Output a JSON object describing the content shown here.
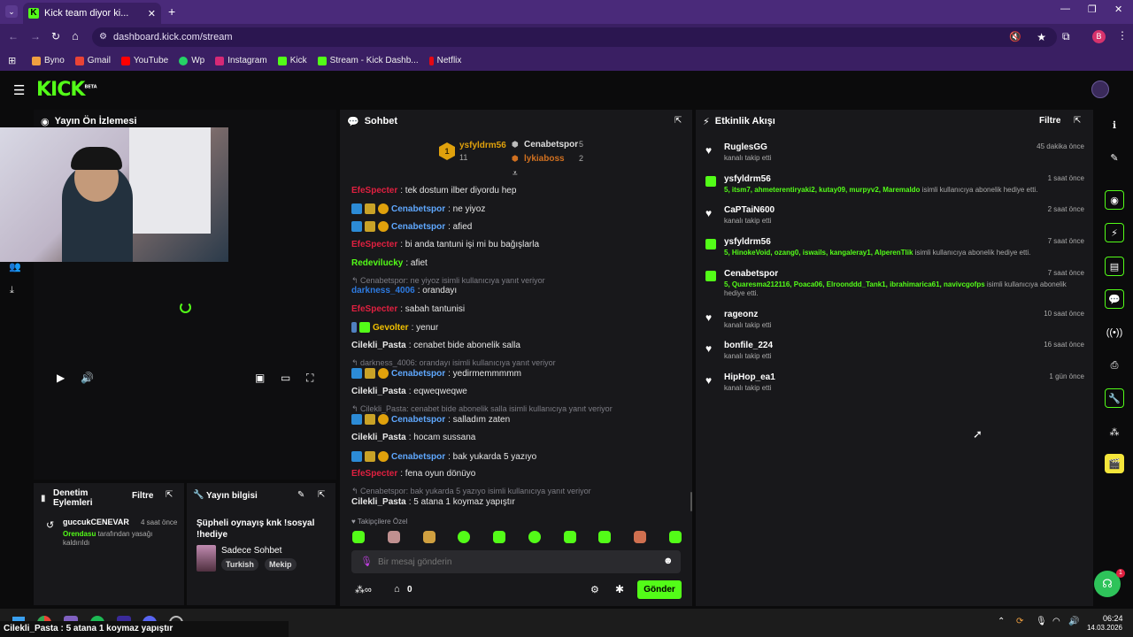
{
  "browser": {
    "tab_title": "Kick team diyor ki...",
    "url": "dashboard.kick.com/stream",
    "bookmarks": [
      "Byno",
      "Gmail",
      "YouTube",
      "Wp",
      "Instagram",
      "Kick",
      "Stream - Kick Dashb...",
      "Netflix"
    ],
    "profile_initial": "B"
  },
  "header": {
    "logo": "KICK",
    "beta": "BETA"
  },
  "preview": {
    "title": "Yayın Ön İzlemesi"
  },
  "moderation": {
    "title": "Denetim Eylemleri",
    "filter": "Filtre",
    "entry": {
      "user": "guccukCENEVAR",
      "time": "4 saat önce",
      "target": "Orendasu",
      "text": "tarafından yasağı kaldırıldı"
    }
  },
  "streaminfo": {
    "title": "Yayın bilgisi",
    "stream_title": "Şüpheli oynayış knk !sosyal !hediye",
    "category": "Sadece Sohbet",
    "tags": [
      "Turkish",
      "Mekip"
    ]
  },
  "chat": {
    "title": "Sohbet",
    "leaders": [
      {
        "name": "ysfyldrm56",
        "count": "11"
      },
      {
        "name": "Cenabetspor",
        "count": "5"
      },
      {
        "name": "lykiaboss",
        "count": "2"
      }
    ],
    "messages": [
      {
        "user": "EfeSpecter",
        "text": ": tek dostum ilber diyordu hep",
        "color": "#e02040"
      },
      {
        "user": "Cenabetspor",
        "text": ": ne yiyoz",
        "color": "#5fa8ff"
      },
      {
        "user": "Cenabetspor",
        "text": ": afied",
        "color": "#5fa8ff"
      },
      {
        "user": "EfeSpecter",
        "text": ": bi anda tantuni işi mi bu bağışlarla",
        "color": "#e02040"
      },
      {
        "user": "Redevilucky",
        "text": ": afiet",
        "color": "#53fc18"
      },
      {
        "reply": "Cenabetspor: ne yiyoz isimli kullanıcıya yanıt veriyor",
        "user": "darkness_4006",
        "text": ": orandayı",
        "color": "#2d7ae0"
      },
      {
        "user": "EfeSpecter",
        "text": ": sabah tantunisi",
        "color": "#e02040"
      },
      {
        "user": "Gevolter",
        "text": ": yenur",
        "color": "#f0c000"
      },
      {
        "user": "Cilekli_Pasta",
        "text": ": cenabet bide abonelik salla",
        "color": "#e8e8e8"
      },
      {
        "reply": "darkness_4006: orandayı isimli kullanıcıya yanıt veriyor",
        "user": "Cenabetspor",
        "text": ": yedirmemmmmm",
        "color": "#5fa8ff"
      },
      {
        "user": "Cilekli_Pasta",
        "text": ": eqweqweqwe",
        "color": "#e8e8e8"
      },
      {
        "reply": "Cilekli_Pasta: cenabet bide abonelik salla isimli kullanıcıya yanıt veriyor",
        "user": "Cenabetspor",
        "text": ": salladım zaten",
        "color": "#5fa8ff"
      },
      {
        "user": "Cilekli_Pasta",
        "text": ": hocam sussana",
        "color": "#e8e8e8"
      },
      {
        "user": "Cenabetspor",
        "text": ": bak yukarda 5 yazıyo",
        "color": "#5fa8ff"
      },
      {
        "user": "EfeSpecter",
        "text": ": fena oyun dönüyo",
        "color": "#e02040"
      },
      {
        "reply": "Cenabetspor: bak yukarda 5 yazıyo isimli kullanıcıya yanıt veriyor",
        "user": "Cilekli_Pasta",
        "text": ": 5 atana 1 koymaz yapıştır",
        "color": "#e8e8e8"
      }
    ],
    "followers_only": "Takipçilere Özel",
    "input_placeholder": "Bir mesaj gönderin",
    "send": "Gönder",
    "counter_value": "0"
  },
  "activity": {
    "title": "Etkinlik Akışı",
    "filter": "Filtre",
    "items": [
      {
        "type": "follow",
        "name": "RuglesGG",
        "time": "45 dakika önce",
        "sub": "kanalı takip etti"
      },
      {
        "type": "gift",
        "name": "ysfyldrm56",
        "time": "1 saat önce",
        "count": "5",
        "users": "itsm7, ahmeterentiryaki2, kutay09, murpyv2, Maremaldo",
        "sub": "isimli kullanıcıya abonelik hediye etti."
      },
      {
        "type": "follow",
        "name": "CaPTaiN600",
        "time": "2 saat önce",
        "sub": "kanalı takip etti"
      },
      {
        "type": "gift",
        "name": "ysfyldrm56",
        "time": "7 saat önce",
        "count": "5",
        "users": "HinokeVoid, ozang0, iswails, kangaleray1, AlperenTlik",
        "sub": "isimli kullanıcıya abonelik hediye etti."
      },
      {
        "type": "gift",
        "name": "Cenabetspor",
        "time": "7 saat önce",
        "count": "5",
        "users": "Quaresma212116, Poaca06, Elroonddd_Tank1, ibrahimarica61, navivcgofps",
        "sub": "isimli kullanıcıya abonelik hediye etti."
      },
      {
        "type": "follow",
        "name": "rageonz",
        "time": "10 saat önce",
        "sub": "kanalı takip etti"
      },
      {
        "type": "follow",
        "name": "bonfile_224",
        "time": "16 saat önce",
        "sub": "kanalı takip etti"
      },
      {
        "type": "follow",
        "name": "HipHop_ea1",
        "time": "1 gün önce",
        "sub": "kanalı takip etti"
      }
    ]
  },
  "taskbar": {
    "notification": "Cilekli_Pasta : 5 atana 1 koymaz yapıştır",
    "time": "06:24",
    "date": "14.03.2026"
  },
  "colors": {
    "accent": "#53fc18",
    "chrome": "#3a1f63",
    "panel": "#18181b"
  }
}
